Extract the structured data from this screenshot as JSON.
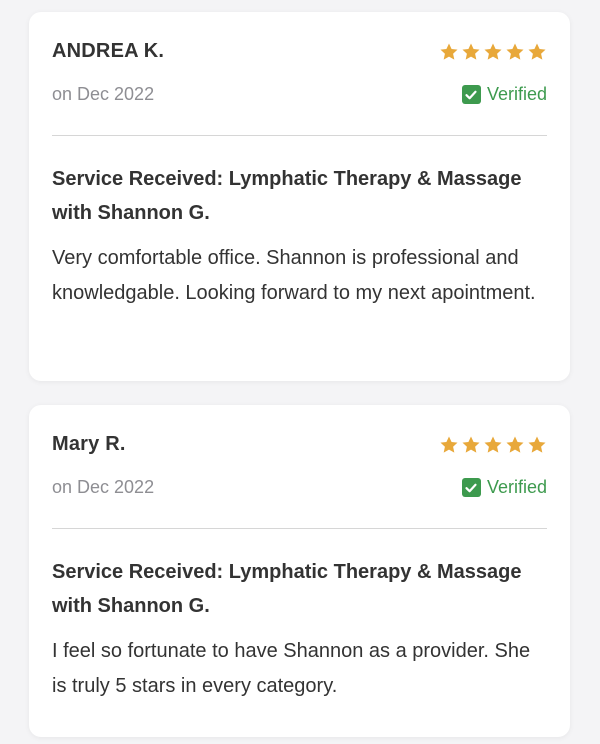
{
  "reviews": [
    {
      "author": "ANDREA K.",
      "date": "on Dec 2022",
      "rating": 5,
      "verified_label": "Verified",
      "service": "Service Received: Lymphatic Therapy & Massage with Shannon G.",
      "text": "Very comfortable office. Shannon is professional and knowledgable. Looking forward to my next apointment."
    },
    {
      "author": "Mary R.",
      "date": "on Dec 2022",
      "rating": 5,
      "verified_label": "Verified",
      "service": "Service Received: Lymphatic Therapy & Massage with Shannon G.",
      "text": "I feel so fortunate to have Shannon as a provider. She is truly 5 stars in every category."
    }
  ],
  "colors": {
    "star": "#e8a83a",
    "verified": "#3d9a4e"
  }
}
